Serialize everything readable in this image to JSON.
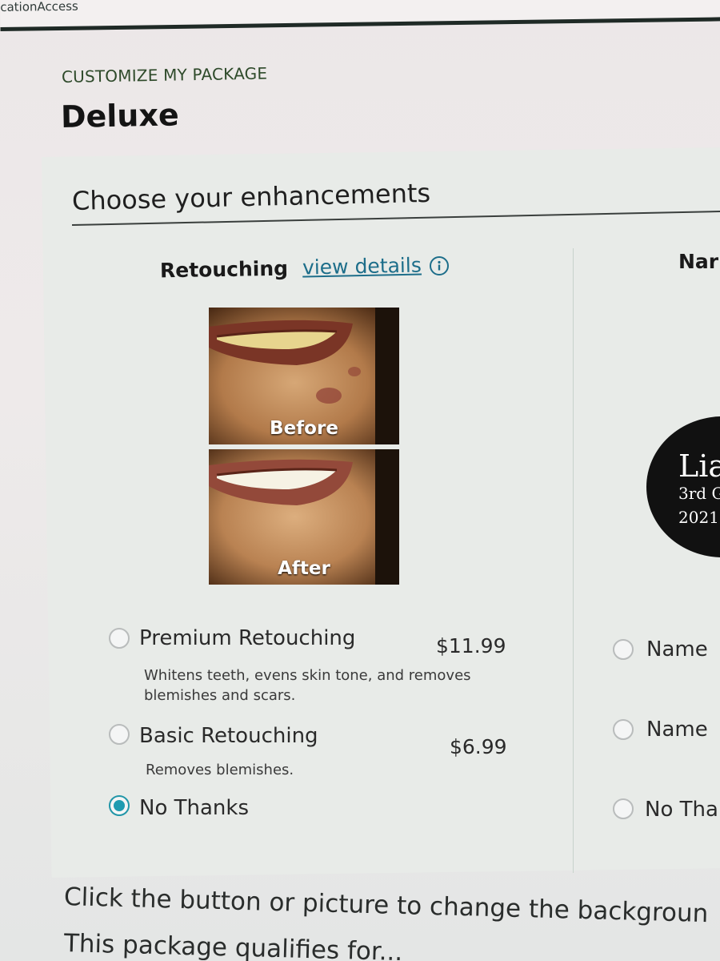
{
  "app": {
    "window_fragment": "icationAccess"
  },
  "page": {
    "eyebrow": "CUSTOMIZE MY PACKAGE",
    "title": "Deluxe"
  },
  "enhancements": {
    "heading": "Choose your enhancements",
    "retouching": {
      "title": "Retouching",
      "details_link": "view details",
      "info_icon": "info-icon",
      "before_label": "Before",
      "after_label": "After",
      "options": [
        {
          "label": "Premium Retouching",
          "price": "$11.99",
          "description_line1": "Whitens teeth, evens skin tone, and removes",
          "description_line2": "blemishes and scars.",
          "selected": false
        },
        {
          "label": "Basic Retouching",
          "price": "$6.99",
          "description_line1": "Removes blemishes.",
          "selected": false
        },
        {
          "label": "No Thanks",
          "selected": true
        }
      ]
    },
    "name_option": {
      "title": "Nar",
      "badge_name": "Lia",
      "badge_line2": "3rd G",
      "badge_line3": "2021",
      "options": [
        {
          "label": "Name",
          "selected": false
        },
        {
          "label": "Name",
          "selected": false
        },
        {
          "label": "No Tha",
          "selected": false
        }
      ]
    }
  },
  "footer": {
    "line1": "Click the button or picture to change the backgroun",
    "line2": "This package qualifies for..."
  },
  "colors": {
    "accent": "#1f9bb0",
    "link": "#1d6e8a",
    "eyebrow": "#2e4a2a"
  }
}
